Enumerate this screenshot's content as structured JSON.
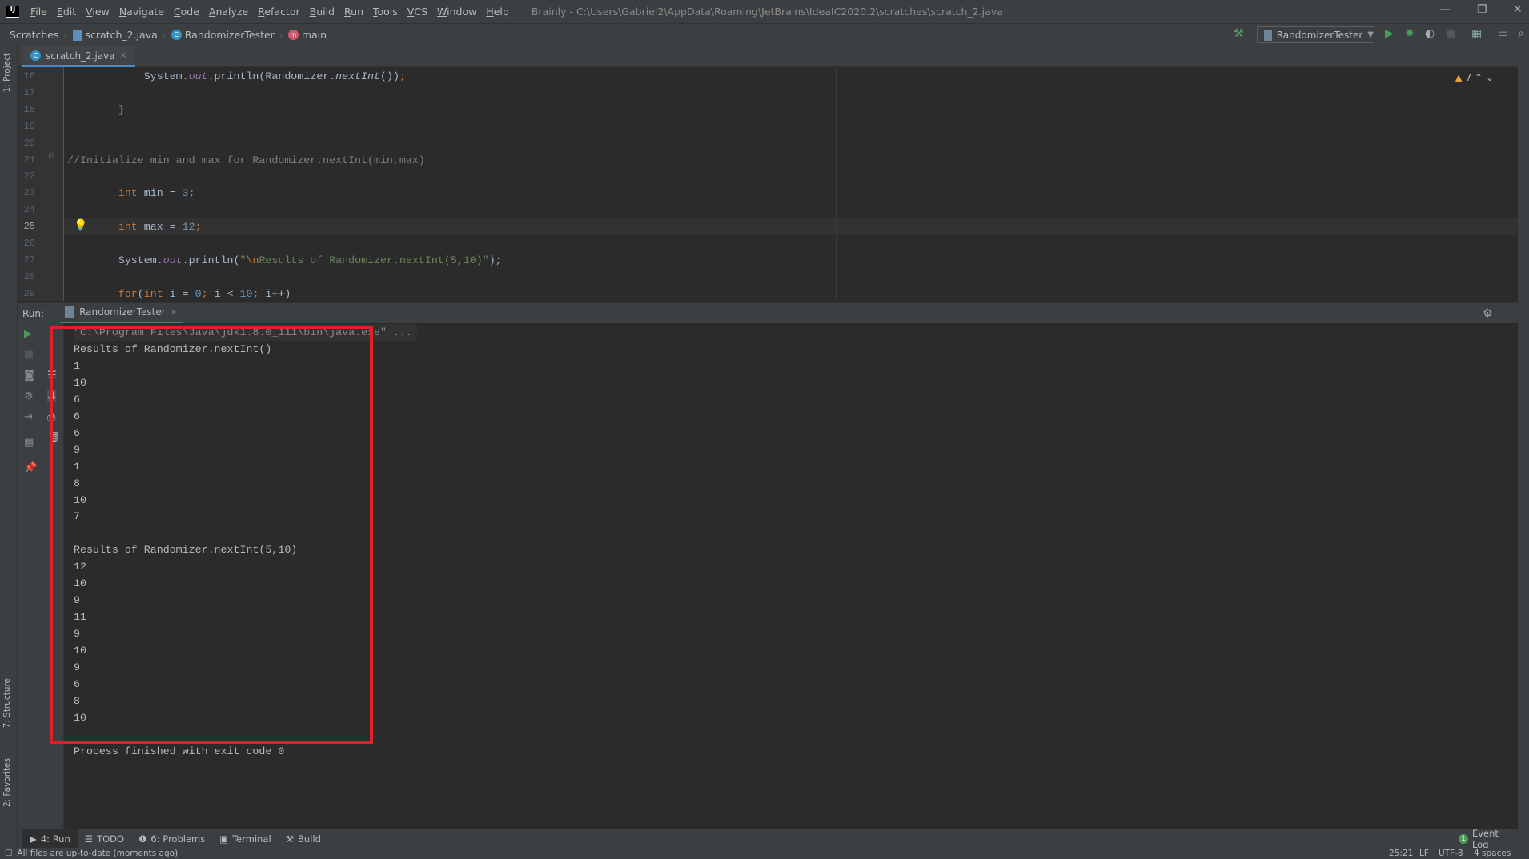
{
  "window": {
    "app_logo": "IJ",
    "title": "Brainly - C:\\Users\\Gabriel2\\AppData\\Roaming\\JetBrains\\IdeaIC2020.2\\scratches\\scratch_2.java"
  },
  "menu": [
    "File",
    "Edit",
    "View",
    "Navigate",
    "Code",
    "Analyze",
    "Refactor",
    "Build",
    "Run",
    "Tools",
    "VCS",
    "Window",
    "Help"
  ],
  "breadcrumb": [
    "Scratches",
    "scratch_2.java",
    "RandomizerTester",
    "main"
  ],
  "toolbar": {
    "run_config": "RandomizerTester"
  },
  "side": {
    "project": "1: Project",
    "structure": "7: Structure",
    "favorites": "2: Favorites"
  },
  "editor": {
    "tab": "scratch_2.java",
    "warnings": "7",
    "current_line": "25",
    "lines": [
      {
        "n": "16",
        "tokens": [
          [
            "            System.",
            ""
          ],
          [
            "out",
            "it"
          ],
          [
            ".println(Randomizer.",
            ""
          ],
          [
            "nextInt",
            "fn"
          ],
          [
            "())",
            ""
          ],
          [
            ";",
            "kw"
          ]
        ]
      },
      {
        "n": "17",
        "tokens": []
      },
      {
        "n": "18",
        "tokens": [
          [
            "        }",
            ""
          ]
        ]
      },
      {
        "n": "19",
        "tokens": []
      },
      {
        "n": "20",
        "tokens": []
      },
      {
        "n": "21",
        "tokens": [
          [
            "//Initialize min and max for Randomizer.nextInt(min,max)",
            "cmt"
          ]
        ]
      },
      {
        "n": "22",
        "tokens": []
      },
      {
        "n": "23",
        "tokens": [
          [
            "        ",
            ""
          ],
          [
            "int",
            "kw"
          ],
          [
            " min = ",
            ""
          ],
          [
            "3",
            "num"
          ],
          [
            ";",
            "kw"
          ]
        ]
      },
      {
        "n": "24",
        "tokens": []
      },
      {
        "n": "25",
        "tokens": [
          [
            "        ",
            ""
          ],
          [
            "int",
            "kw"
          ],
          [
            " max = ",
            ""
          ],
          [
            "12",
            "num"
          ],
          [
            ";",
            "kw"
          ]
        ]
      },
      {
        "n": "26",
        "tokens": []
      },
      {
        "n": "27",
        "tokens": [
          [
            "        System.",
            ""
          ],
          [
            "out",
            "it"
          ],
          [
            ".println(",
            ""
          ],
          [
            "\"",
            "str"
          ],
          [
            "\\n",
            "esc"
          ],
          [
            "Results of Randomizer.nextInt(5,10)\"",
            "str"
          ],
          [
            ");",
            ""
          ]
        ]
      },
      {
        "n": "28",
        "tokens": []
      },
      {
        "n": "29",
        "tokens": [
          [
            "        ",
            ""
          ],
          [
            "for",
            "kw"
          ],
          [
            "(",
            ""
          ],
          [
            "int",
            "kw"
          ],
          [
            " i = ",
            ""
          ],
          [
            "0",
            "num"
          ],
          [
            "; ",
            "kw"
          ],
          [
            "i < ",
            ""
          ],
          [
            "10",
            "num"
          ],
          [
            "; ",
            "kw"
          ],
          [
            "i++)",
            ""
          ]
        ]
      }
    ]
  },
  "run": {
    "label": "Run:",
    "tab": "RandomizerTester",
    "output": [
      "\"C:\\Program Files\\Java\\jdk1.8.0_111\\bin\\java.exe\" ...",
      "Results of Randomizer.nextInt()",
      "1",
      "10",
      "6",
      "6",
      "6",
      "9",
      "1",
      "8",
      "10",
      "7",
      "",
      "Results of Randomizer.nextInt(5,10)",
      "12",
      "10",
      "9",
      "11",
      "9",
      "10",
      "9",
      "6",
      "8",
      "10",
      "",
      "Process finished with exit code 0"
    ]
  },
  "tool_windows": [
    {
      "label": "4: Run",
      "icon": "▶"
    },
    {
      "label": "TODO",
      "icon": "☰"
    },
    {
      "label": "6: Problems",
      "icon": "❶"
    },
    {
      "label": "Terminal",
      "icon": "▣"
    },
    {
      "label": "Build",
      "icon": "⚒"
    }
  ],
  "event_log": "Event Log",
  "event_count": "1",
  "status": {
    "message": "All files are up-to-date (moments ago)",
    "position": "25:21",
    "line_sep": "LF",
    "encoding": "UTF-8",
    "indent": "4 spaces"
  },
  "colors": {
    "highlight_box": "#e0202a",
    "accent": "#4a88c7"
  }
}
